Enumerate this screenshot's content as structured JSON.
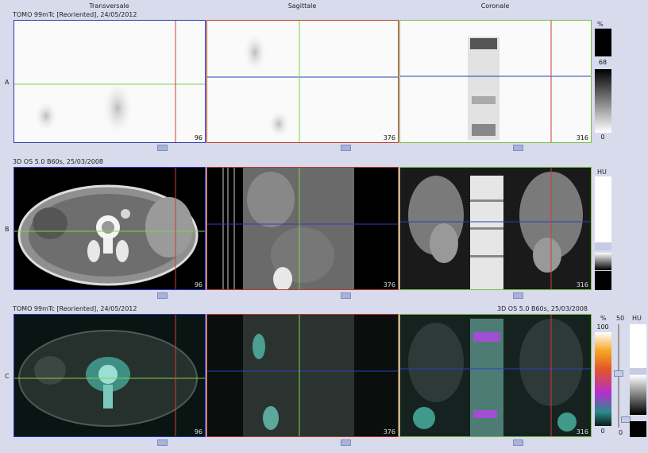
{
  "headers": {
    "transversale": "Transversale",
    "sagittale": "Sagittale",
    "coronale": "Coronale"
  },
  "rows": {
    "a": {
      "label": "A",
      "series": "TOMO 99mTc [Reoriented], 24/05/2012",
      "slices": [
        "96",
        "376",
        "316"
      ]
    },
    "b": {
      "label": "B",
      "series": "3D  OS  5.0  B60s, 25/03/2008",
      "slices": [
        "96",
        "376",
        "316"
      ]
    },
    "c": {
      "label": "C",
      "series_left": "TOMO 99mTc [Reoriented], 24/05/2012",
      "series_right": "3D  OS  5.0  B60s, 25/03/2008",
      "slices": [
        "96",
        "376",
        "316"
      ]
    }
  },
  "scales": {
    "a": {
      "unit": "%",
      "value": "68",
      "min": "0"
    },
    "b": {
      "unit": "HU"
    },
    "c": {
      "unit_pct": "%",
      "pct_max": "100",
      "pct_min": "0",
      "blend": "50",
      "blend_min": "0",
      "unit_hu": "HU"
    }
  },
  "colors": {
    "green": "#7fd24a",
    "red": "#d43a3a",
    "blue": "#2c3fbf",
    "frame_red": "#c0392b",
    "frame_green": "#76c043",
    "frame_blue": "#2b38b5"
  }
}
